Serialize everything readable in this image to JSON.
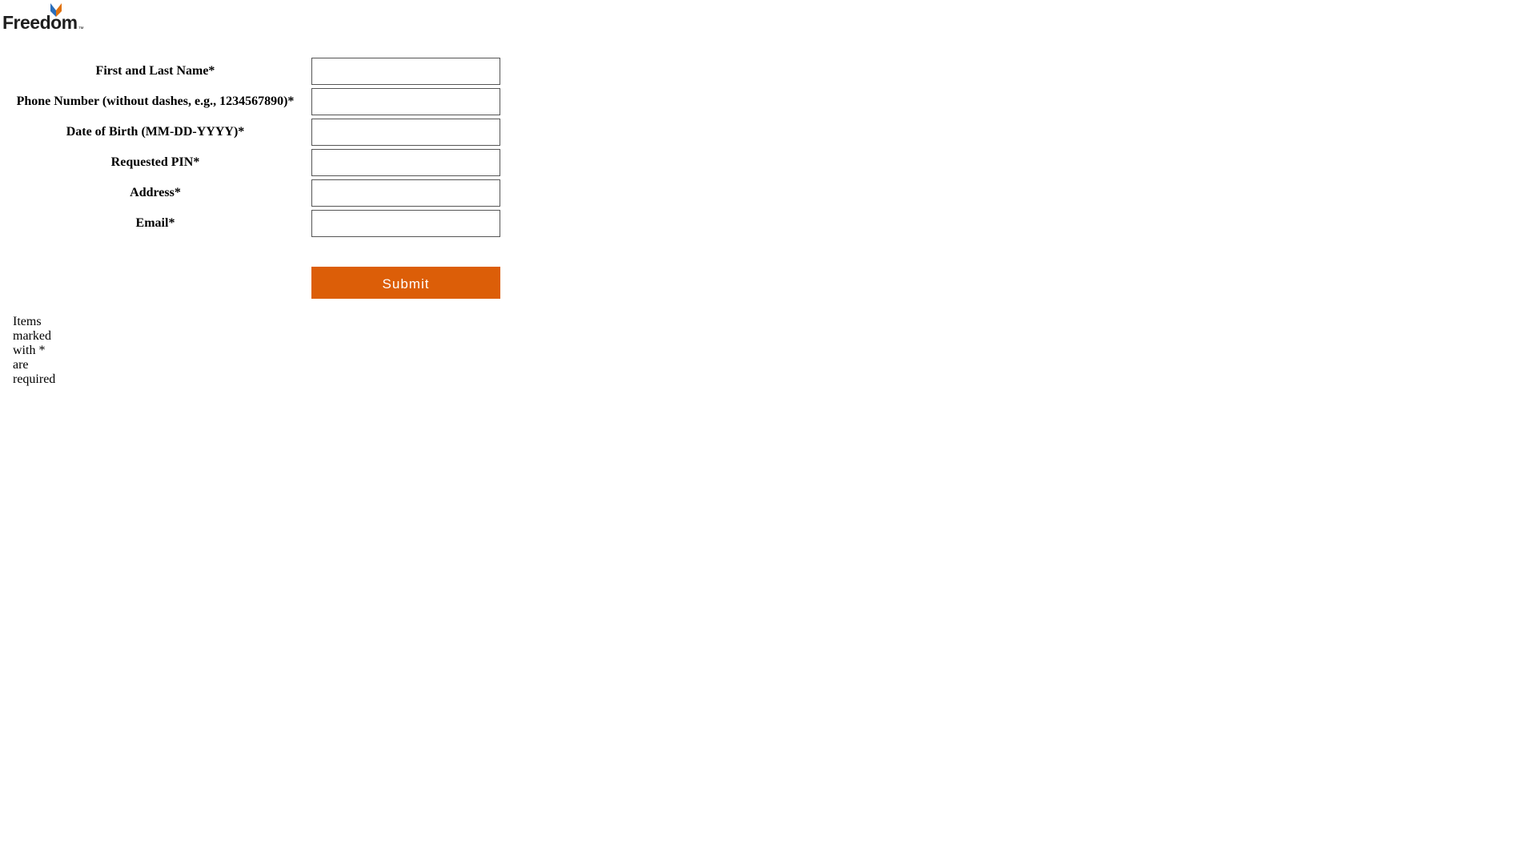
{
  "logo": {
    "text": "Freedom",
    "tm": "™",
    "icon": "freedom-logo-mark",
    "colors": {
      "blue": "#2a6ebb",
      "orange": "#e0720f",
      "text": "#1f1f1f"
    }
  },
  "form": {
    "fields": [
      {
        "label": "First and Last Name*",
        "value": ""
      },
      {
        "label": "Phone Number (without dashes, e.g., 1234567890)*",
        "value": ""
      },
      {
        "label": "Date of Birth (MM-DD-YYYY)*",
        "value": ""
      },
      {
        "label": "Requested PIN*",
        "value": ""
      },
      {
        "label": "Address*",
        "value": ""
      },
      {
        "label": "Email*",
        "value": ""
      }
    ],
    "submit_label": "Submit",
    "required_note": "Items marked with * are required"
  },
  "colors": {
    "accent": "#dc5e08",
    "input_border": "#555555",
    "background": "#ffffff"
  }
}
